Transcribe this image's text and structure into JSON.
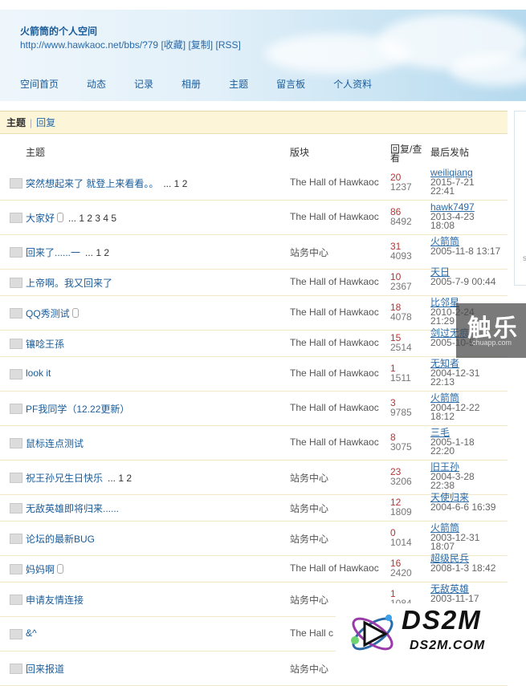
{
  "header": {
    "title": "火箭筒的个人空间",
    "url_text": "http://www.hawkaoc.net/bbs/?79",
    "links": [
      "[收藏]",
      "[复制]",
      "[RSS]"
    ]
  },
  "nav": [
    "空间首页",
    "动态",
    "记录",
    "相册",
    "主题",
    "留言板",
    "个人资料"
  ],
  "tabs": {
    "active": "主题",
    "other": "回复"
  },
  "columns": {
    "subject": "主题",
    "board": "版块",
    "stats_line1": "回复/查",
    "stats_line2": "看",
    "last": "最后发帖"
  },
  "rows": [
    {
      "subject": "突然想起来了 就登上来看看。。",
      "pages": "... 1 2",
      "attach": false,
      "board": "The Hall of Hawkaoc",
      "replies": "20",
      "views": "1237",
      "author": "weiliqiang",
      "time": "2015-7-21 22:41"
    },
    {
      "subject": "大家好",
      "pages": "... 1 2 3 4 5",
      "attach": true,
      "board": "The Hall of Hawkaoc",
      "replies": "86",
      "views": "8492",
      "author": "hawk7497",
      "time": "2013-4-23 18:08"
    },
    {
      "subject": "回来了......一",
      "pages": "... 1 2",
      "attach": false,
      "board": "站务中心",
      "replies": "31",
      "views": "4093",
      "author": "火箭筒",
      "time": "2005-11-8 13:17"
    },
    {
      "subject": "上帝啊。我又回来了",
      "pages": "",
      "attach": false,
      "board": "The Hall of Hawkaoc",
      "replies": "10",
      "views": "2367",
      "author": "天日",
      "time": "2005-7-9 00:44"
    },
    {
      "subject": "QQ秀测试",
      "pages": "",
      "attach": true,
      "board": "The Hall of Hawkaoc",
      "replies": "18",
      "views": "4078",
      "author": "比邻星",
      "time": "2010-2-24 21:29"
    },
    {
      "subject": "镶唸王孫",
      "pages": "",
      "attach": false,
      "board": "The Hall of Hawkaoc",
      "replies": "15",
      "views": "2514",
      "author": "剑过无痕",
      "time": "2005-10-5"
    },
    {
      "subject": "look it",
      "pages": "",
      "attach": false,
      "board": "The Hall of Hawkaoc",
      "replies": "1",
      "views": "1511",
      "author": "无知者",
      "time": "2004-12-31 22:13"
    },
    {
      "subject": "PF我同学（12.22更新）",
      "pages": "",
      "attach": false,
      "board": "The Hall of Hawkaoc",
      "replies": "3",
      "views": "9785",
      "author": "火箭筒",
      "time": "2004-12-22 18:12"
    },
    {
      "subject": "鼠标连点测试",
      "pages": "",
      "attach": false,
      "board": "The Hall of Hawkaoc",
      "replies": "8",
      "views": "3075",
      "author": "三毛",
      "time": "2005-1-18 22:20"
    },
    {
      "subject": "祝王孙兄生日快乐",
      "pages": "... 1 2",
      "attach": false,
      "board": "站务中心",
      "replies": "23",
      "views": "3206",
      "author": "旧王孙",
      "time": "2004-3-28 22:38"
    },
    {
      "subject": "无敌英雄即将归来......",
      "pages": "",
      "attach": false,
      "board": "站务中心",
      "replies": "12",
      "views": "1809",
      "author": "天使归来",
      "time": "2004-6-6 16:39"
    },
    {
      "subject": "论坛的最新BUG",
      "pages": "",
      "attach": false,
      "board": "站务中心",
      "replies": "0",
      "views": "1014",
      "author": "火箭筒",
      "time": "2003-12-31 18:07"
    },
    {
      "subject": "妈妈啊",
      "pages": "",
      "attach": true,
      "board": "The Hall of Hawkaoc",
      "replies": "16",
      "views": "2420",
      "author": "超级民兵",
      "time": "2008-1-3 18:42"
    },
    {
      "subject": "申请友情连接",
      "pages": "",
      "attach": false,
      "board": "站务中心",
      "replies": "1",
      "views": "1084",
      "author": "无敌英雄",
      "time": "2003-11-17 17:40"
    },
    {
      "subject": "&^",
      "pages": "",
      "attach": false,
      "board": "The Hall c",
      "replies": "",
      "views": "",
      "author": "",
      "time": ""
    },
    {
      "subject": "回来报道",
      "pages": "",
      "attach": false,
      "board": "站务中心",
      "replies": "",
      "views": "",
      "author": "",
      "time": ""
    }
  ],
  "watermarks": {
    "chulee": "触乐",
    "chulee_sub": "chuapp.com",
    "ds2m": "DS2M",
    "ds2m_sub": "DS2M.COM"
  }
}
